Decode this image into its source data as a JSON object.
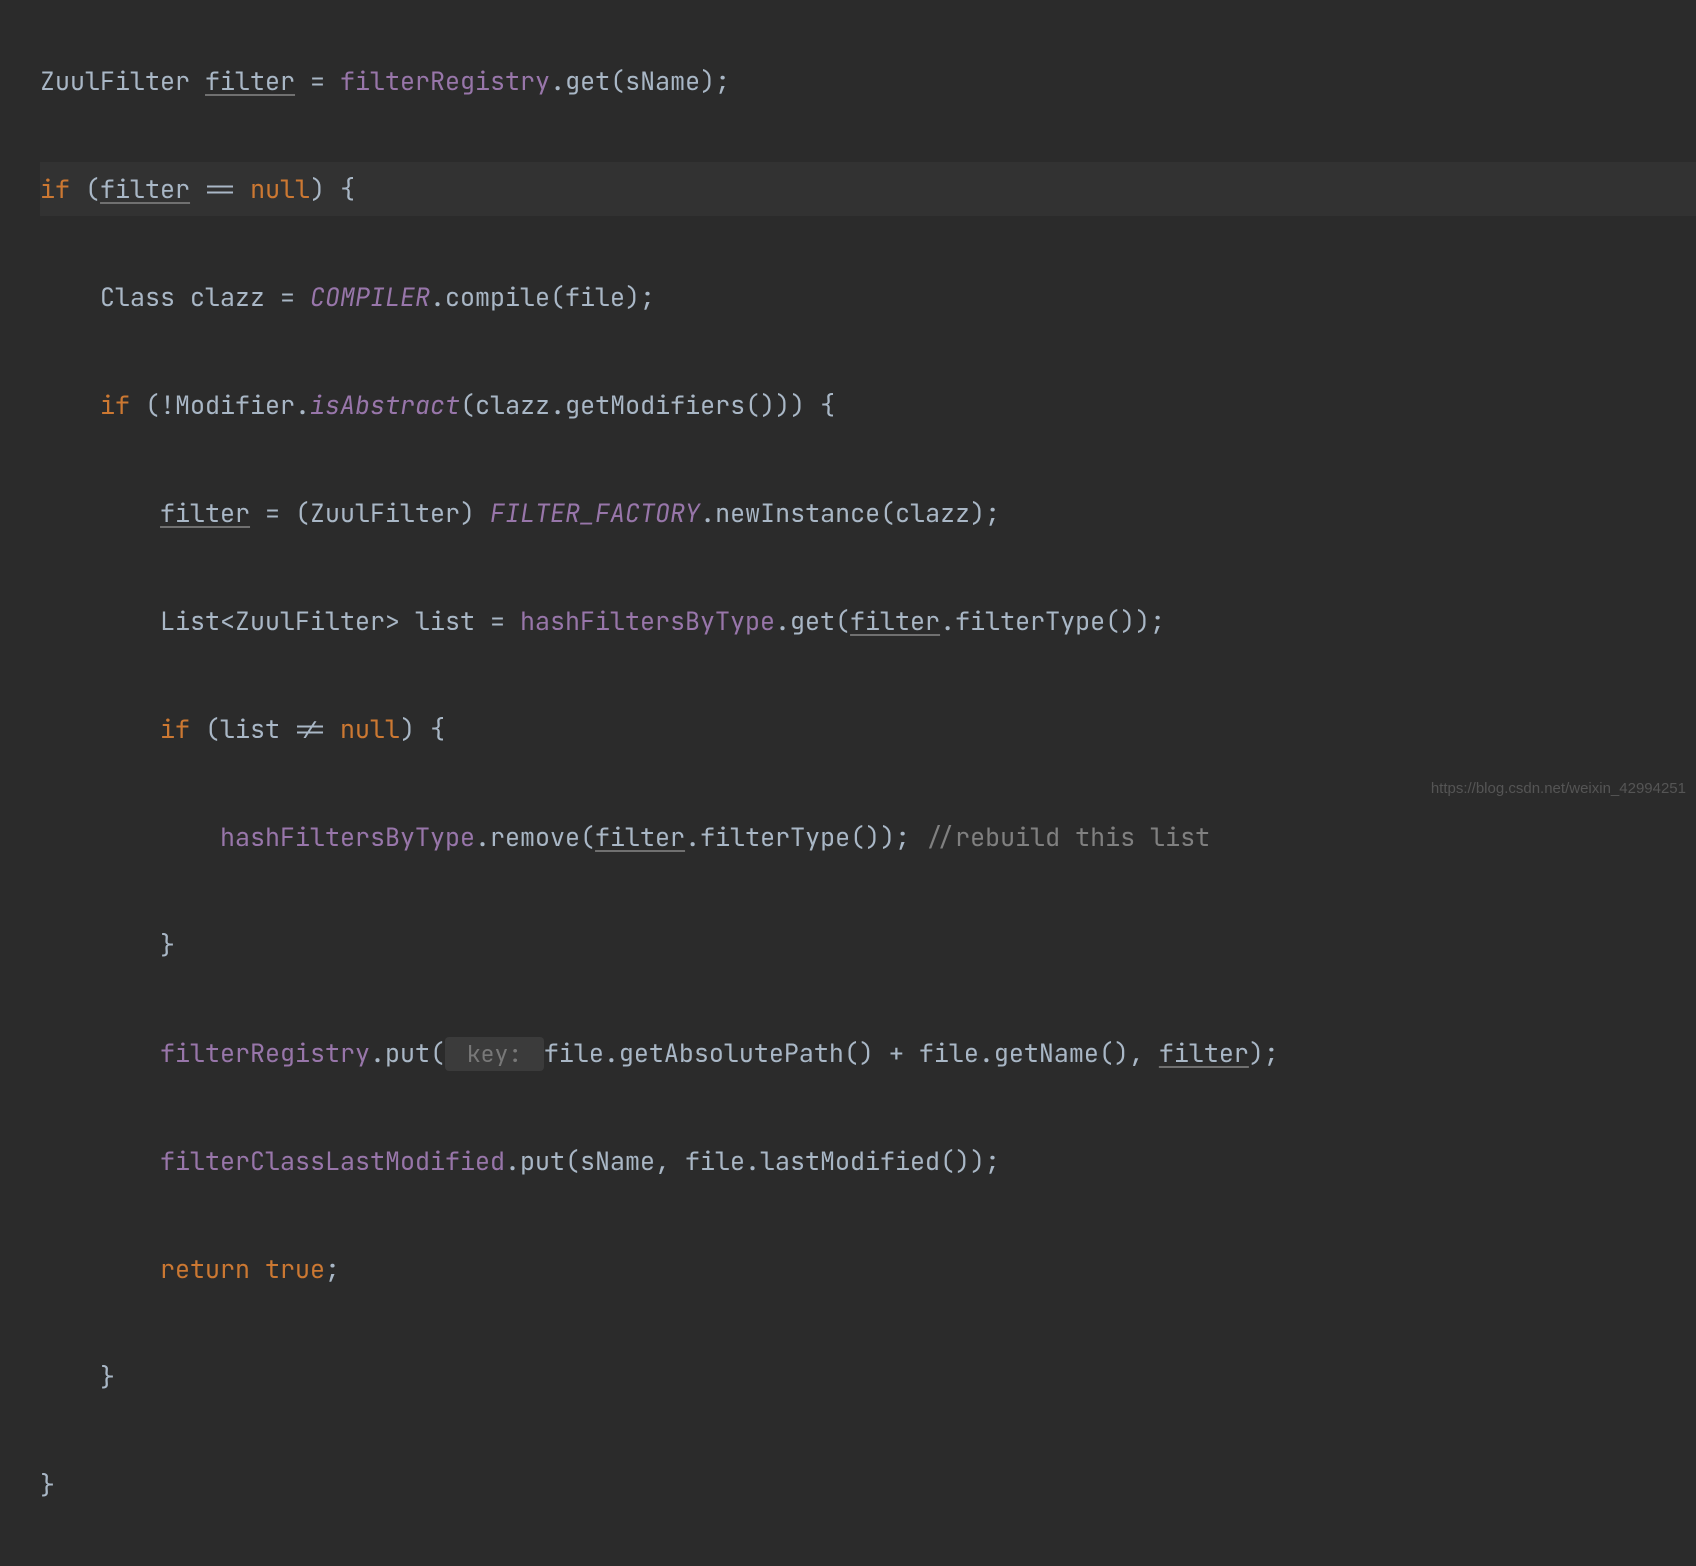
{
  "watermark": "https://blog.csdn.net/weixin_42994251",
  "tokens": {
    "l1": {
      "t1": "ZuulFilter ",
      "t2": "filter",
      "t3": " = ",
      "t4": "filterRegistry",
      "t5": ".get(sName);"
    },
    "l2": {
      "t1": "if",
      "t2": " (",
      "t3": "filter",
      "t4": " == ",
      "t5": "null",
      "t6": ") {"
    },
    "l3": {
      "t1": "    Class clazz = ",
      "t2": "COMPILER",
      "t3": ".compile(file);"
    },
    "l4": {
      "t1": "    ",
      "t2": "if",
      "t3": " (!Modifier.",
      "t4": "isAbstract",
      "t5": "(clazz.getModifiers())) {"
    },
    "l5": {
      "t1": "        ",
      "t2": "filter",
      "t3": " = (ZuulFilter) ",
      "t4": "FILTER_FACTORY",
      "t5": ".newInstance(clazz);"
    },
    "l6": {
      "t1": "        List<ZuulFilter> list = ",
      "t2": "hashFiltersByType",
      "t3": ".get(",
      "t4": "filter",
      "t5": ".filterType());"
    },
    "l7": {
      "t1": "        ",
      "t2": "if",
      "t3": " (list != ",
      "t4": "null",
      "t5": ") {"
    },
    "l8": {
      "t1": "            ",
      "t2": "hashFiltersByType",
      "t3": ".remove(",
      "t4": "filter",
      "t5": ".filterType()); ",
      "t6": "//rebuild this list"
    },
    "l9": {
      "t1": "        }"
    },
    "l10": {
      "t1": "        ",
      "t2": "filterRegistry",
      "t3": ".put(",
      "hint": " key: ",
      "t4": "file.getAbsolutePath() + file.getName(), ",
      "t5": "filter",
      "t6": ");"
    },
    "l11": {
      "t1": "        ",
      "t2": "filterClassLastModified",
      "t3": ".put(sName, file.lastModified());"
    },
    "l12": {
      "t1": "        ",
      "t2": "return true",
      "t3": ";"
    },
    "l13": {
      "t1": "    }"
    },
    "l14": {
      "t1": "}"
    }
  }
}
